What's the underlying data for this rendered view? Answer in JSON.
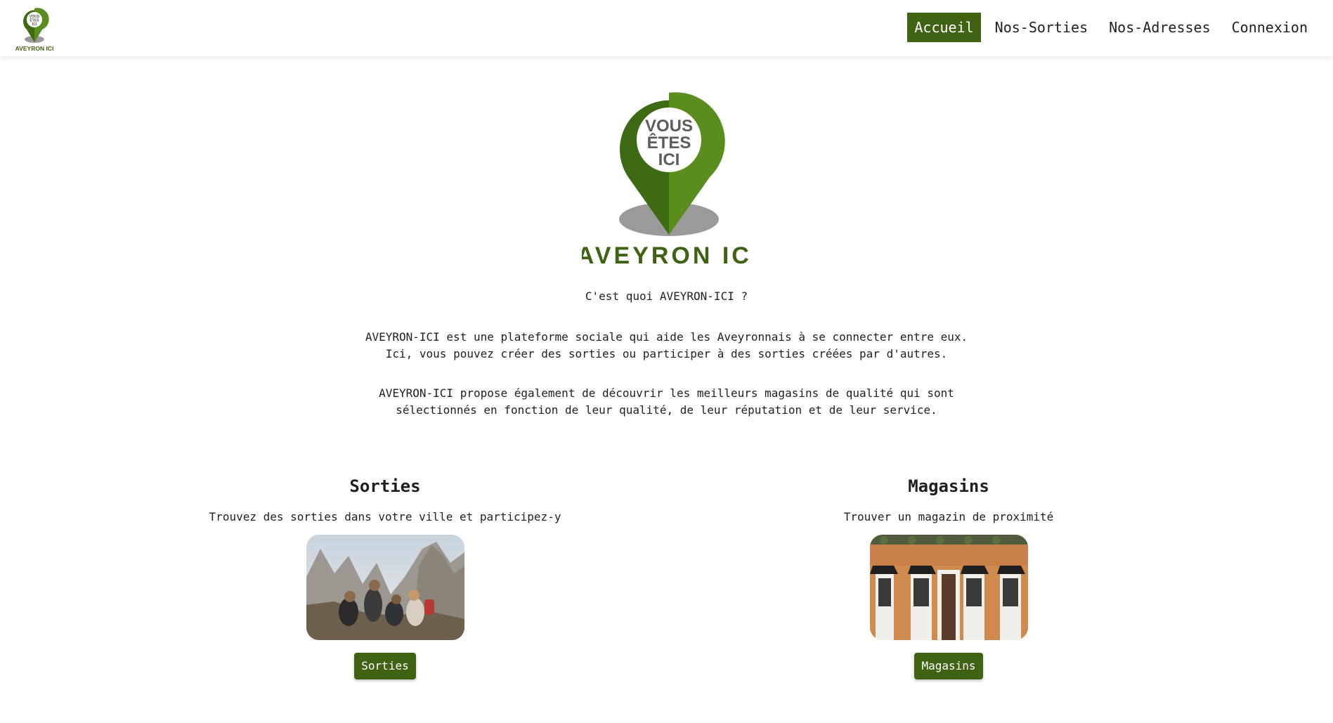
{
  "header": {
    "logo_text_lines": [
      "VOUS",
      "ÊTES",
      "ICI"
    ],
    "logo_brand": "AVEYRON ICI",
    "nav": [
      {
        "label": "Accueil",
        "active": true
      },
      {
        "label": "Nos-Sorties",
        "active": false
      },
      {
        "label": "Nos-Adresses",
        "active": false
      },
      {
        "label": "Connexion",
        "active": false
      }
    ]
  },
  "hero": {
    "logo_text_lines": [
      "VOUS",
      "ÊTES",
      "ICI"
    ],
    "brand": "AVEYRON ICI"
  },
  "about": {
    "title": "C'est quoi AVEYRON-ICI ?",
    "paragraph1": [
      "AVEYRON-ICI est une plateforme sociale qui aide les Aveyronnais à se connecter entre eux.",
      "Ici, vous pouvez créer des sorties ou participer à des sorties créées par d'autres."
    ],
    "paragraph2": [
      "AVEYRON-ICI propose également de découvrir les meilleurs magasins de qualité qui sont",
      "sélectionnés en fonction de leur qualité, de leur réputation et de leur service."
    ]
  },
  "features": {
    "sorties": {
      "title": "Sorties",
      "description": "Trouvez des sorties dans votre ville et participez-y",
      "button": "Sorties"
    },
    "magasins": {
      "title": "Magasins",
      "description": "Trouver un magazin de proximité",
      "button": "Magasins"
    }
  },
  "colors": {
    "brand_green": "#3f6213",
    "pin_dark": "#3f6a14",
    "pin_light": "#5a8c1e",
    "shadow_gray": "#9a9a9a"
  }
}
